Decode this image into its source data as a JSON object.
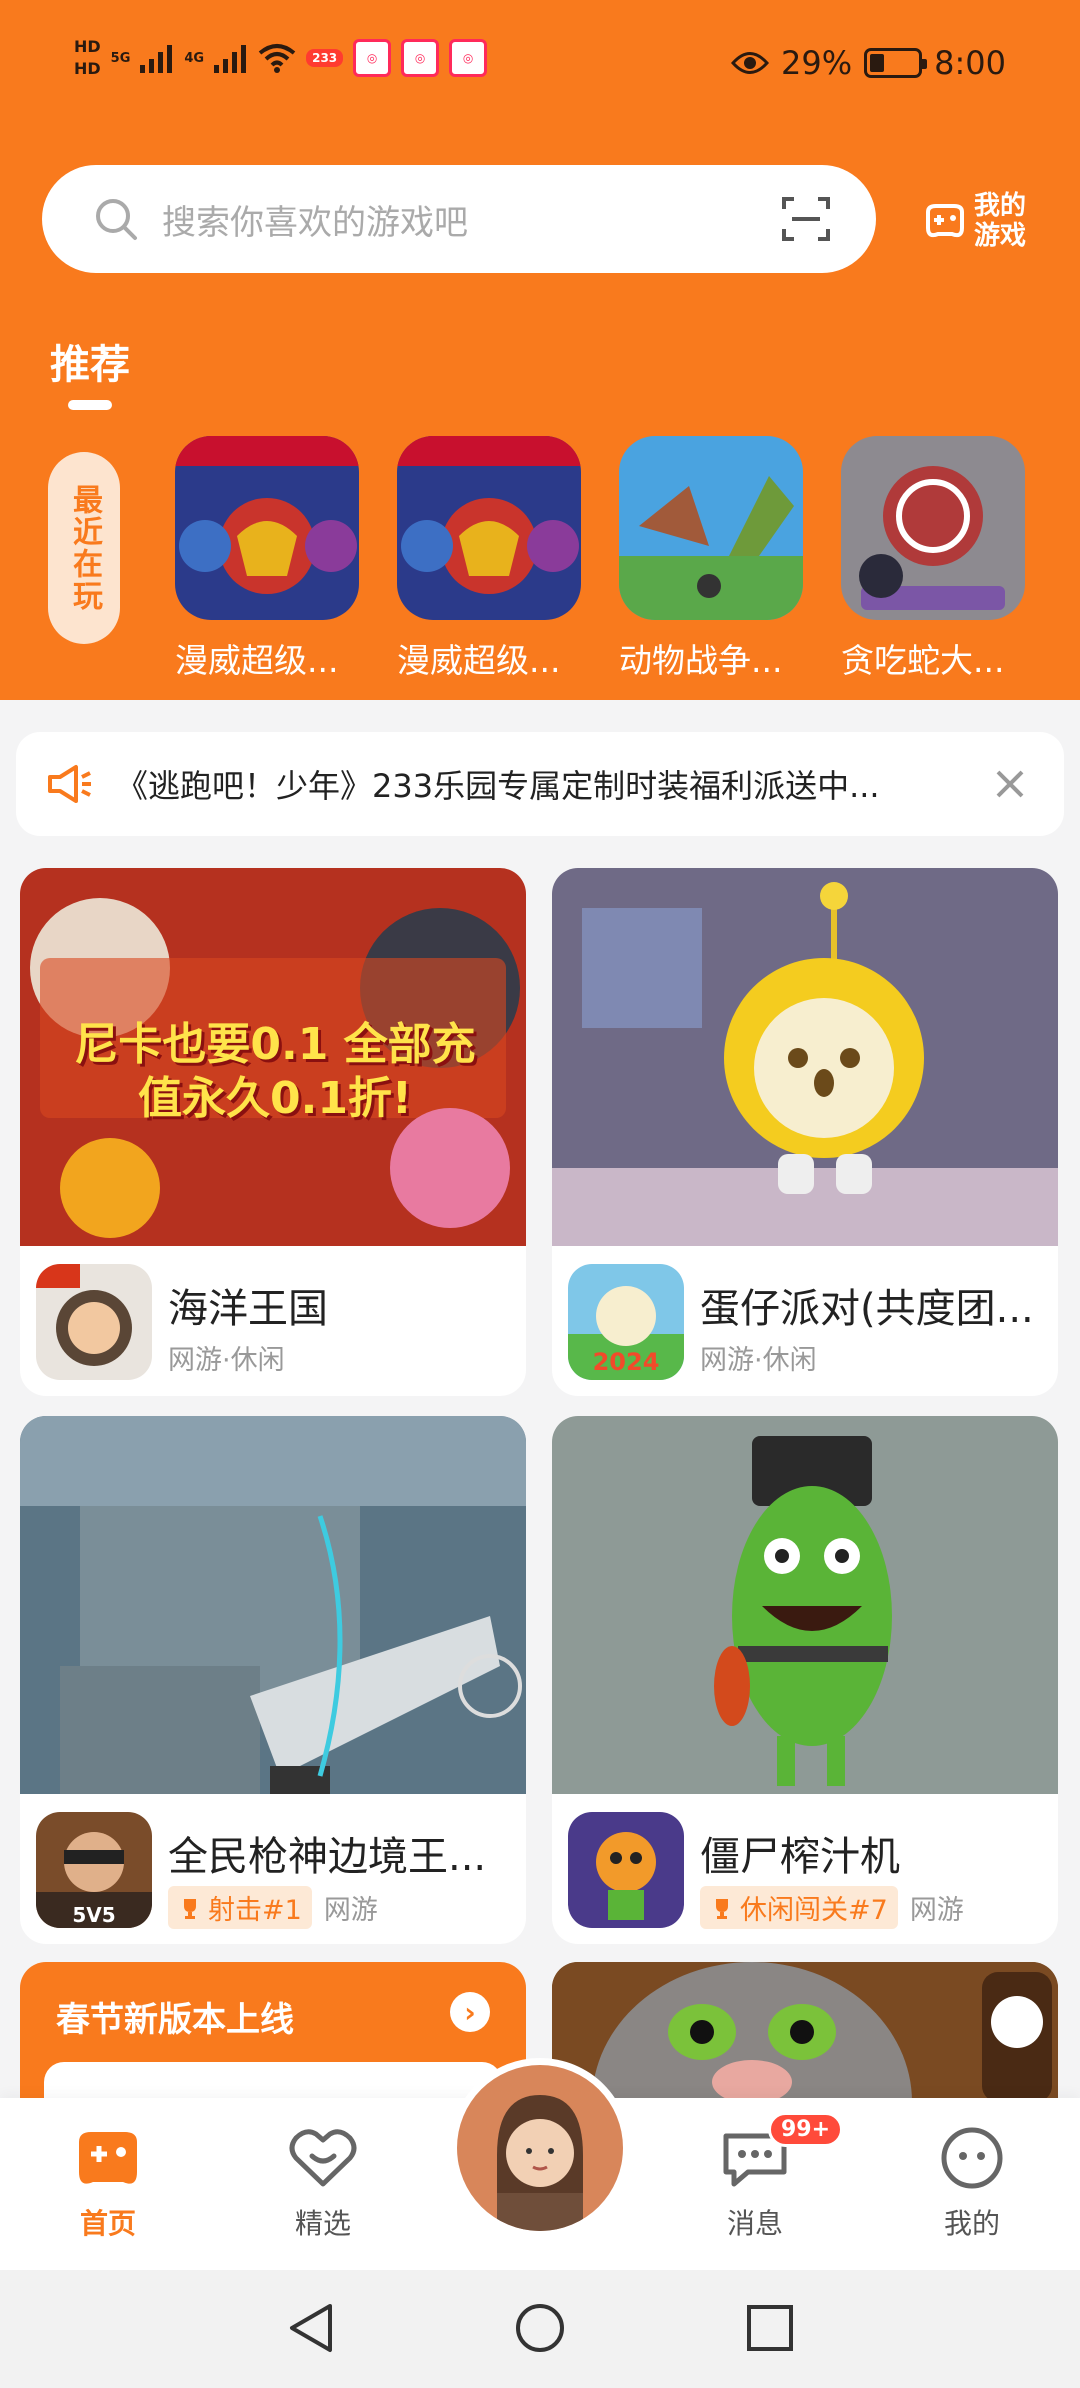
{
  "status_bar": {
    "left": [
      "HD",
      "HD",
      "5G",
      "4G"
    ],
    "badge": "233",
    "battery_percent": "29%",
    "battery_level": 0.29,
    "time": "8:00"
  },
  "search": {
    "placeholder": "搜索你喜欢的游戏吧"
  },
  "my_games_label": "我的游戏",
  "tab": "推荐",
  "recent": {
    "label": "最近在玩",
    "items": [
      {
        "name": "漫威超级..."
      },
      {
        "name": "漫威超级..."
      },
      {
        "name": "动物战争..."
      },
      {
        "name": "贪吃蛇大..."
      }
    ]
  },
  "notice": {
    "text": "《逃跑吧！少年》233乐园专属定制时装福利派送中..."
  },
  "cards": [
    {
      "title": "海洋王国",
      "sub": "网游·休闲",
      "rank": "",
      "banner_text": "尼卡也要0.1 全部充值永久0.1折!"
    },
    {
      "title": "蛋仔派对(共度团...",
      "sub": "网游·休闲",
      "rank": ""
    },
    {
      "title": "全民枪神边境王...",
      "sub": "网游",
      "rank": "射击#1"
    },
    {
      "title": "僵尸榨汁机",
      "sub": "网游",
      "rank": "休闲闯关#7"
    }
  ],
  "promo": {
    "title": "春节新版本上线"
  },
  "bottom_nav": [
    {
      "label": "首页",
      "active": true
    },
    {
      "label": "精选",
      "active": false
    },
    {
      "label": "消息",
      "active": false,
      "badge": "99+"
    },
    {
      "label": "我的",
      "active": false
    }
  ],
  "colors": {
    "brand": "#f97a1d",
    "accent_light": "#fde4cf"
  }
}
